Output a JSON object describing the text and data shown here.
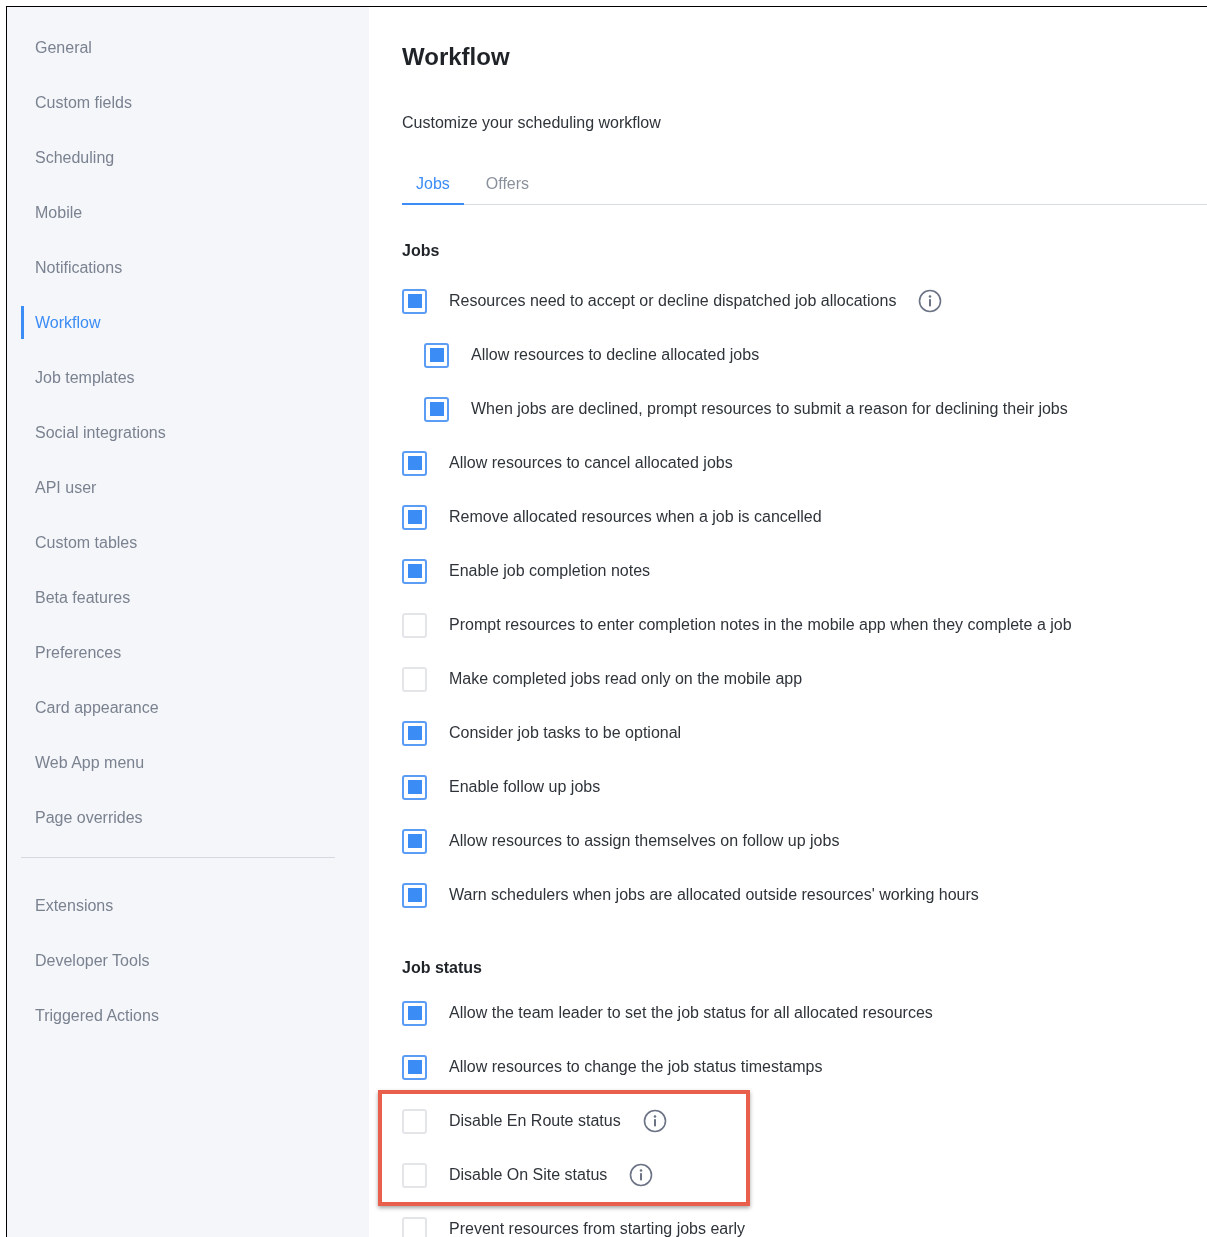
{
  "sidebar": {
    "items": [
      {
        "label": "General",
        "selected": false
      },
      {
        "label": "Custom fields",
        "selected": false
      },
      {
        "label": "Scheduling",
        "selected": false
      },
      {
        "label": "Mobile",
        "selected": false
      },
      {
        "label": "Notifications",
        "selected": false
      },
      {
        "label": "Workflow",
        "selected": true
      },
      {
        "label": "Job templates",
        "selected": false
      },
      {
        "label": "Social integrations",
        "selected": false
      },
      {
        "label": "API user",
        "selected": false
      },
      {
        "label": "Custom tables",
        "selected": false
      },
      {
        "label": "Beta features",
        "selected": false
      },
      {
        "label": "Preferences",
        "selected": false
      },
      {
        "label": "Card appearance",
        "selected": false
      },
      {
        "label": "Web App menu",
        "selected": false
      },
      {
        "label": "Page overrides",
        "selected": false
      }
    ],
    "extra_items": [
      {
        "label": "Extensions",
        "selected": false
      },
      {
        "label": "Developer Tools",
        "selected": false
      },
      {
        "label": "Triggered Actions",
        "selected": false
      }
    ]
  },
  "page": {
    "title": "Workflow",
    "subtitle": "Customize your scheduling workflow"
  },
  "tabs": [
    {
      "label": "Jobs",
      "selected": true
    },
    {
      "label": "Offers",
      "selected": false
    }
  ],
  "sections": [
    {
      "heading": "Jobs",
      "items": [
        {
          "label": "Resources need to accept or decline dispatched job allocations",
          "checked": true,
          "info": true,
          "highlighted": false,
          "children": [
            {
              "label": "Allow resources to decline allocated jobs",
              "checked": true,
              "info": false,
              "highlighted": false
            },
            {
              "label": "When jobs are declined, prompt resources to submit a reason for declining their jobs",
              "checked": true,
              "info": false,
              "highlighted": false
            }
          ]
        },
        {
          "label": "Allow resources to cancel allocated jobs",
          "checked": true,
          "info": false,
          "highlighted": false
        },
        {
          "label": "Remove allocated resources when a job is cancelled",
          "checked": true,
          "info": false,
          "highlighted": false
        },
        {
          "label": "Enable job completion notes",
          "checked": true,
          "info": false,
          "highlighted": false
        },
        {
          "label": "Prompt resources to enter completion notes in the mobile app when they complete a job",
          "checked": false,
          "info": false,
          "highlighted": false
        },
        {
          "label": "Make completed jobs read only on the mobile app",
          "checked": false,
          "info": false,
          "highlighted": false
        },
        {
          "label": "Consider job tasks to be optional",
          "checked": true,
          "info": false,
          "highlighted": false
        },
        {
          "label": "Enable follow up jobs",
          "checked": true,
          "info": false,
          "highlighted": false
        },
        {
          "label": "Allow resources to assign themselves on follow up jobs",
          "checked": true,
          "info": false,
          "highlighted": false
        },
        {
          "label": "Warn schedulers when jobs are allocated outside resources' working hours",
          "checked": true,
          "info": false,
          "highlighted": false
        }
      ]
    },
    {
      "heading": "Job status",
      "items": [
        {
          "label": "Allow the team leader to set the job status for all allocated resources",
          "checked": true,
          "info": false,
          "highlighted": false
        },
        {
          "label": "Allow resources to change the job status timestamps",
          "checked": true,
          "info": false,
          "highlighted": false
        },
        {
          "label": "Disable En Route status",
          "checked": false,
          "info": true,
          "highlighted": true
        },
        {
          "label": "Disable On Site status",
          "checked": false,
          "info": true,
          "highlighted": true
        },
        {
          "label": "Prevent resources from starting jobs early",
          "checked": false,
          "info": false,
          "highlighted": false
        }
      ]
    }
  ]
}
